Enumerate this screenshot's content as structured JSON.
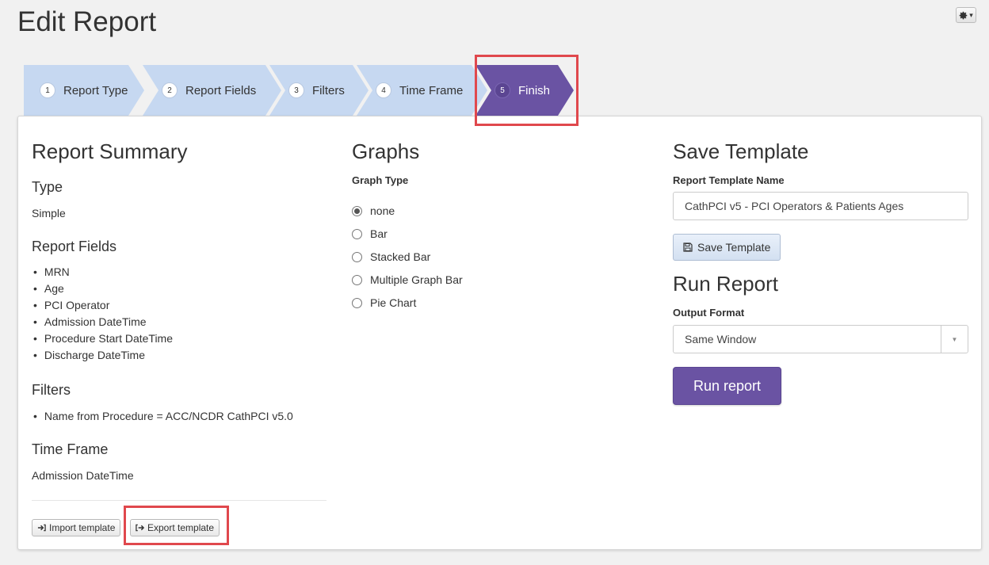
{
  "page": {
    "title": "Edit Report",
    "gear_caret": "▾"
  },
  "wizard": {
    "steps": [
      {
        "num": "1",
        "label": "Report Type"
      },
      {
        "num": "2",
        "label": "Report Fields"
      },
      {
        "num": "3",
        "label": "Filters"
      },
      {
        "num": "4",
        "label": "Time Frame"
      },
      {
        "num": "5",
        "label": "Finish",
        "active": true
      }
    ]
  },
  "summary": {
    "title": "Report Summary",
    "type_heading": "Type",
    "type_value": "Simple",
    "fields_heading": "Report Fields",
    "fields": [
      "MRN",
      "Age",
      "PCI Operator",
      "Admission DateTime",
      "Procedure Start DateTime",
      "Discharge DateTime"
    ],
    "filters_heading": "Filters",
    "filters": [
      "Name from Procedure = ACC/NCDR CathPCI v5.0"
    ],
    "timeframe_heading": "Time Frame",
    "timeframe_value": "Admission DateTime",
    "import_label": "Import template",
    "export_label": "Export template"
  },
  "graphs": {
    "title": "Graphs",
    "type_label": "Graph Type",
    "options": [
      "none",
      "Bar",
      "Stacked Bar",
      "Multiple Graph Bar",
      "Pie Chart"
    ],
    "selected": "none"
  },
  "template": {
    "title": "Save Template",
    "name_label": "Report Template Name",
    "name_value": "CathPCI v5 - PCI Operators & Patients Ages",
    "save_label": "Save Template"
  },
  "run": {
    "title": "Run Report",
    "output_label": "Output Format",
    "output_value": "Same Window",
    "run_label": "Run report"
  },
  "colors": {
    "accent": "#6a53a3",
    "step": "#c6d8f1",
    "highlight": "#e0484d"
  }
}
